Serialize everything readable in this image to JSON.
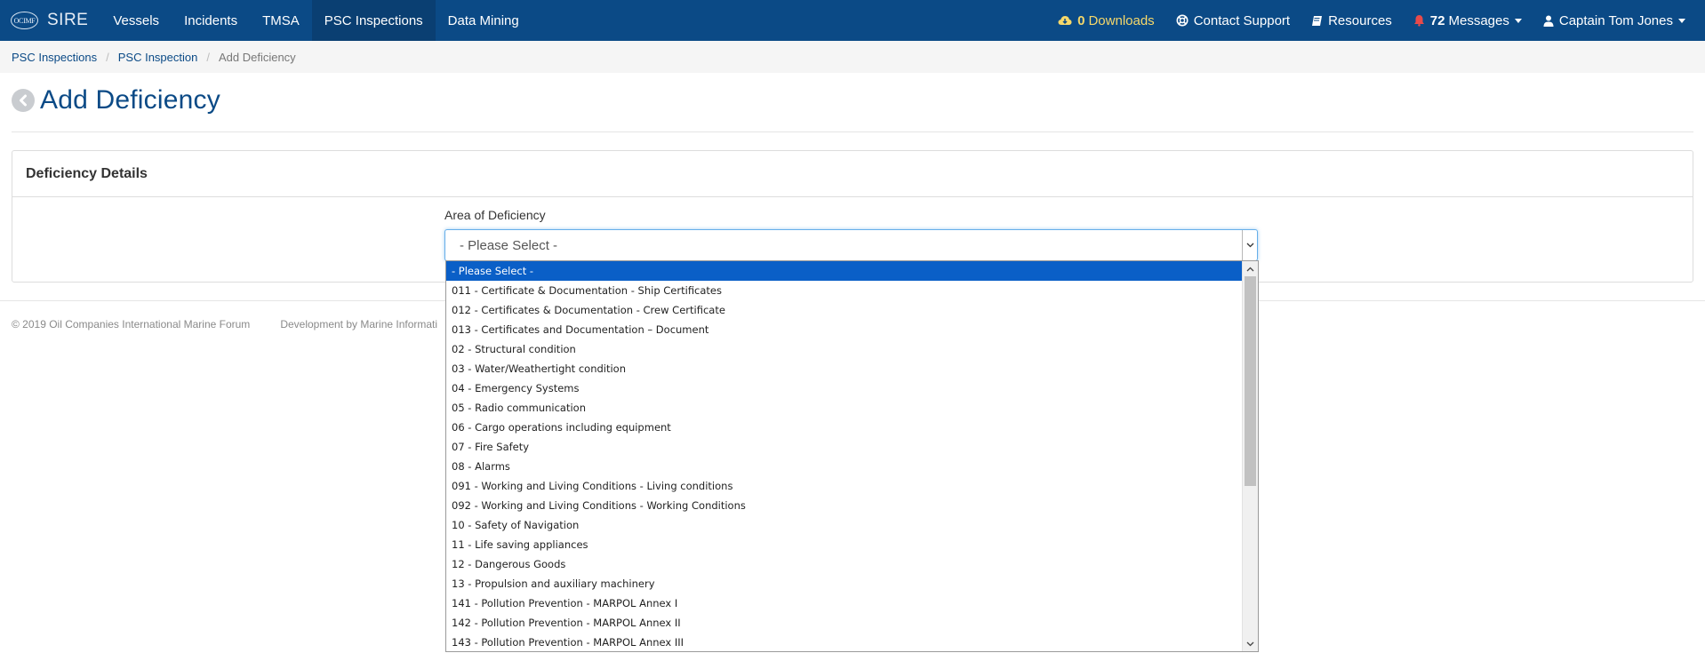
{
  "navbar": {
    "brand_logo": "OCIMF",
    "brand_name": "SIRE",
    "items": [
      {
        "label": "Vessels",
        "active": false
      },
      {
        "label": "Incidents",
        "active": false
      },
      {
        "label": "TMSA",
        "active": false
      },
      {
        "label": "PSC Inspections",
        "active": true
      },
      {
        "label": "Data Mining",
        "active": false
      }
    ],
    "downloads_count": "0",
    "downloads_label": "Downloads",
    "support_label": "Contact Support",
    "resources_label": "Resources",
    "messages_count": "72",
    "messages_label": "Messages",
    "user_label": "Captain Tom Jones",
    "colors": {
      "bar": "#0b4a86",
      "active": "#0a3f72",
      "downloads": "#f6d86a",
      "bell": "#e84a4a"
    }
  },
  "breadcrumb": {
    "items": [
      "PSC Inspections",
      "PSC Inspection"
    ],
    "current": "Add Deficiency"
  },
  "page": {
    "title": "Add Deficiency"
  },
  "panel": {
    "heading": "Deficiency Details",
    "field_label": "Area of Deficiency",
    "select_value": "- Please Select -"
  },
  "footer": {
    "copyright": "© 2019 Oil Companies International Marine Forum",
    "development": "Development by Marine Informati"
  },
  "dropdown": {
    "selected_index": 0,
    "options": [
      "- Please Select -",
      "011 - Certificate & Documentation - Ship Certificates",
      "012 - Certificates & Documentation - Crew Certificate",
      "013 - Certificates and Documentation – Document",
      "02 - Structural condition",
      "03 - Water/Weathertight condition",
      "04 - Emergency Systems",
      "05 - Radio communication",
      "06 - Cargo operations including equipment",
      "07 - Fire Safety",
      "08 - Alarms",
      "091 - Working and Living Conditions - Living conditions",
      "092 - Working and Living Conditions - Working Conditions",
      "10 - Safety of Navigation",
      "11 - Life saving appliances",
      "12 - Dangerous Goods",
      "13 - Propulsion and auxiliary machinery",
      "141 - Pollution Prevention - MARPOL Annex I",
      "142 - Pollution Prevention - MARPOL Annex II",
      "143 - Pollution Prevention - MARPOL Annex III"
    ]
  }
}
